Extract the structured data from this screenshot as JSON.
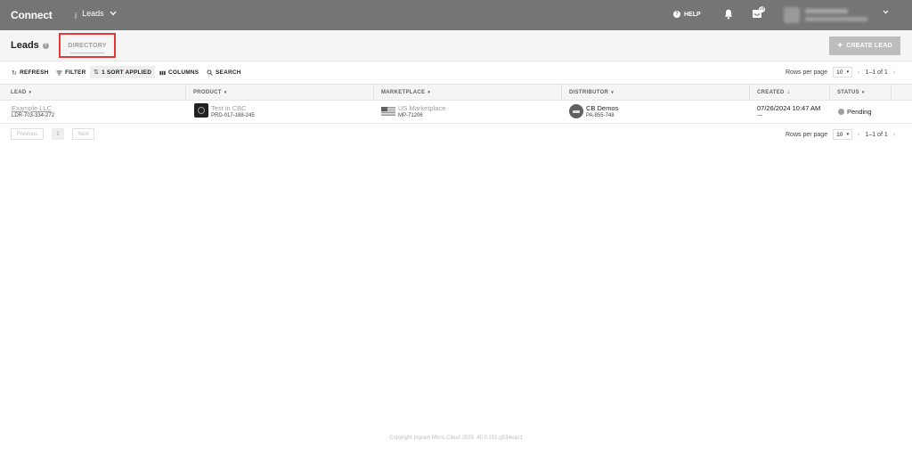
{
  "topbar": {
    "brand": "Connect",
    "module_label": "Leads",
    "help_label": "HELP",
    "inbox_count": "28"
  },
  "header": {
    "title": "Leads",
    "tab_directory": "DIRECTORY",
    "create_button": "CREATE LEAD"
  },
  "toolbar": {
    "refresh": "REFRESH",
    "filter": "FILTER",
    "sort": "1 SORT APPLIED",
    "columns": "COLUMNS",
    "search": "SEARCH",
    "rows_per_page_label": "Rows per page",
    "rows_per_page_value": "10",
    "range": "1–1 of 1"
  },
  "table": {
    "columns": [
      "LEAD",
      "PRODUCT",
      "MARKETPLACE",
      "DISTRIBUTOR",
      "CREATED",
      "STATUS"
    ],
    "rows": [
      {
        "lead_name": "Example LLC",
        "lead_id": "LDR-703-334-272",
        "product_name": "Test in CBC",
        "product_id": "PRD-017-188-245",
        "marketplace_name": "US Marketplace",
        "marketplace_id": "MP-71206",
        "distributor_name": "CB Demos",
        "distributor_id": "PA-855-748",
        "created": "07/26/2024 10:47 AM",
        "created_by": "—",
        "status": "Pending"
      }
    ]
  },
  "pagination": {
    "previous": "Previous",
    "page": "1",
    "next": "Next",
    "rows_per_page_label": "Rows per page",
    "rows_per_page_value": "10",
    "range": "1–1 of 1"
  },
  "footer": "Copyright Ingram Micro Cloud 2025. 40.0.151-g534eac1",
  "colors": {
    "topbar": "#757575",
    "highlight_border": "#e53935",
    "create_button": "#bdbdbd"
  }
}
